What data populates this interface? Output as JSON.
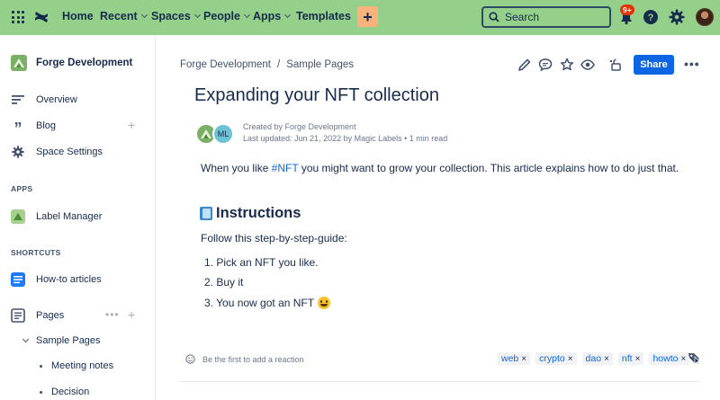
{
  "topnav": {
    "items": [
      {
        "label": "Home",
        "dropdown": false
      },
      {
        "label": "Recent",
        "dropdown": true
      },
      {
        "label": "Spaces",
        "dropdown": true
      },
      {
        "label": "People",
        "dropdown": true
      },
      {
        "label": "Apps",
        "dropdown": true
      },
      {
        "label": "Templates",
        "dropdown": false
      }
    ],
    "create_label": "+",
    "search_placeholder": "Search",
    "notification_badge": "9+",
    "bg_color": "#94d08a"
  },
  "sidebar": {
    "space_name": "Forge Development",
    "items": [
      {
        "label": "Overview",
        "icon": "overview-icon"
      },
      {
        "label": "Blog",
        "icon": "quote-icon"
      },
      {
        "label": "Space Settings",
        "icon": "gear-icon"
      }
    ],
    "apps_heading": "APPS",
    "apps": [
      {
        "label": "Label Manager",
        "icon": "label-manager-icon"
      }
    ],
    "shortcuts_heading": "SHORTCUTS",
    "shortcuts": [
      {
        "label": "How-to articles",
        "icon": "document-icon"
      }
    ],
    "pages_label": "Pages",
    "tree": {
      "parent": "Sample Pages",
      "children": [
        "Meeting notes",
        "Decision"
      ]
    }
  },
  "breadcrumb": [
    "Forge Development",
    "/",
    "Sample Pages"
  ],
  "toolbar": {
    "share_label": "Share",
    "more_label": "•••"
  },
  "page": {
    "title": "Expanding your NFT collection",
    "byline_created": "Created by Forge Development",
    "byline_updated": "Last updated: Jun 21, 2022 by Magic Labels • 1 min read",
    "author_initials": "ML",
    "intro_before": "When you like ",
    "intro_hashtag": "#NFT",
    "intro_after": " you might want to grow your collection. This article explains how to do just that.",
    "heading": "Instructions",
    "follow": "Follow this step-by-step-guide:",
    "steps": [
      "1. Pick an NFT you like.",
      "2. Buy it",
      "3. You now got an NFT"
    ]
  },
  "reaction_text": "Be the first to add a reaction",
  "labels": [
    "web",
    "crypto",
    "dao",
    "nft",
    "howto"
  ],
  "label_remove": "×"
}
